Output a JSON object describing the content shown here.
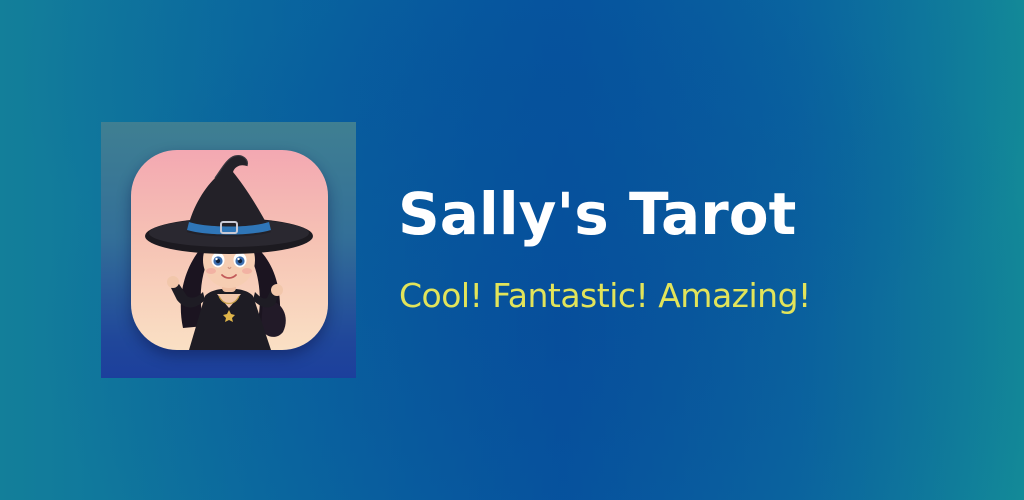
{
  "app": {
    "title": "Sally's Tarot",
    "tagline": "Cool! Fantastic! Amazing!"
  },
  "icon": {
    "name": "witch-character-icon"
  },
  "colors": {
    "background_center": "#0656a0",
    "background_edge": "#137f9a",
    "title_text": "#ffffff",
    "tagline_text": "#e2e45a",
    "icon_tile_top": "#f3a8b2",
    "icon_tile_bottom": "#fae0c4",
    "hat_band": "#2f76b8"
  }
}
